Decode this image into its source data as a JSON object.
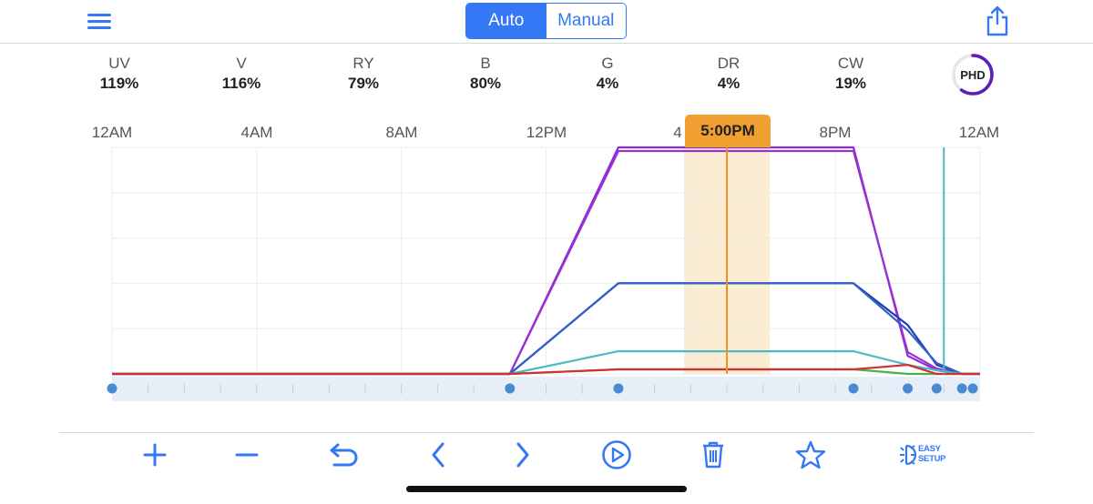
{
  "header": {
    "modes": [
      {
        "label": "Auto",
        "active": true
      },
      {
        "label": "Manual",
        "active": false
      }
    ],
    "menu_icon": "hamburger-menu-icon",
    "share_icon": "share-icon"
  },
  "channels": [
    {
      "name": "UV",
      "value": "119%"
    },
    {
      "name": "V",
      "value": "116%"
    },
    {
      "name": "RY",
      "value": "79%"
    },
    {
      "name": "B",
      "value": "80%"
    },
    {
      "name": "G",
      "value": "4%"
    },
    {
      "name": "DR",
      "value": "4%"
    },
    {
      "name": "CW",
      "value": "19%"
    }
  ],
  "phd_badge": {
    "label": "PHD",
    "progress": 0.6,
    "color": "#5a1fb5"
  },
  "timeline": {
    "time_labels": [
      "12AM",
      "4AM",
      "8AM",
      "12PM",
      "4",
      "8PM",
      "12AM"
    ],
    "current_time_label": "5:00PM",
    "current_time_hours": 17
  },
  "chart_data": {
    "type": "line",
    "x_unit": "hours since 12AM",
    "xlim": [
      0,
      24
    ],
    "ylim": [
      0,
      125
    ],
    "current_time": 17,
    "control_points_hours": [
      0,
      11,
      14,
      20.5,
      22,
      22.8,
      23.5,
      23.8
    ],
    "series": [
      {
        "color": "#8a2be2",
        "x": [
          0,
          11,
          14,
          20.5,
          22,
          22.8,
          23.5,
          24
        ],
        "y": [
          0,
          0,
          125,
          125,
          10,
          2,
          0,
          0
        ]
      },
      {
        "color": "#9b30d0",
        "x": [
          0,
          11,
          14,
          20.5,
          22,
          22.8,
          23.5,
          24
        ],
        "y": [
          0,
          0,
          123,
          123,
          12,
          3,
          0,
          0
        ]
      },
      {
        "color": "#1e3db0",
        "x": [
          0,
          11,
          14,
          20.5,
          22,
          22.8,
          23.5,
          24
        ],
        "y": [
          0,
          0,
          50,
          50,
          27,
          5,
          0,
          0
        ]
      },
      {
        "color": "#2f5fc8",
        "x": [
          0,
          11,
          14,
          20.5,
          22,
          22.8,
          23.5,
          24
        ],
        "y": [
          0,
          0,
          50,
          50,
          24,
          6,
          0,
          0
        ]
      },
      {
        "color": "#4db8c8",
        "x": [
          0,
          11,
          14,
          20.5,
          22,
          22.8,
          23.5,
          24
        ],
        "y": [
          0,
          0,
          12.5,
          12.5,
          5,
          2,
          0,
          0
        ]
      },
      {
        "color": "#4caf50",
        "x": [
          0,
          11,
          14,
          20.5,
          22,
          22.8,
          23.5,
          24
        ],
        "y": [
          0,
          0,
          2.5,
          2.5,
          0,
          0,
          0,
          0
        ]
      },
      {
        "color": "#d32f2f",
        "x": [
          0,
          11,
          14,
          20.5,
          22,
          22.8,
          23.5,
          24
        ],
        "y": [
          0,
          0,
          2.5,
          2.5,
          5,
          0,
          0,
          0
        ]
      }
    ],
    "marker_line": {
      "x": 23,
      "color": "#4db8c8"
    }
  },
  "toolbar": {
    "tools": [
      "add-icon",
      "remove-icon",
      "undo-icon",
      "previous-icon",
      "next-icon",
      "play-icon",
      "delete-icon",
      "favorite-icon"
    ],
    "easy_setup": {
      "line1": "EASY",
      "line2": "SETUP"
    }
  }
}
